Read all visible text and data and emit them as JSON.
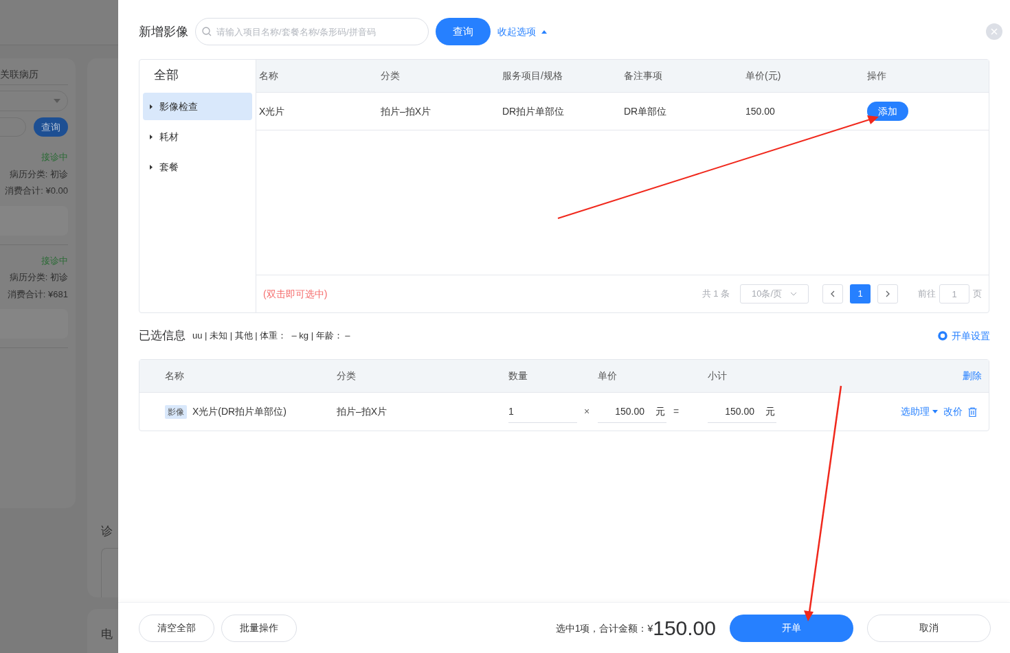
{
  "background_page": {
    "panel_title": "关联病历",
    "query_button": "查询",
    "records": [
      {
        "status": "接诊中",
        "category": "病历分类: 初诊",
        "total": "消费合计: ¥0.00"
      },
      {
        "status": "接诊中",
        "category": "病历分类: 初诊",
        "total": "消费合计: ¥681"
      }
    ],
    "section_labels": [
      "诊",
      "电"
    ]
  },
  "dialog": {
    "title": "新增影像",
    "search": {
      "placeholder": "请输入项目名称/套餐名称/条形码/拼音码"
    },
    "query_button": "查询",
    "collapse_link": "收起选项",
    "categories": {
      "all": "全部",
      "items": [
        {
          "label": "影像检查",
          "selected": true
        },
        {
          "label": "耗材",
          "selected": false
        },
        {
          "label": "套餐",
          "selected": false
        }
      ]
    },
    "catalog_table": {
      "columns": [
        "名称",
        "分类",
        "服务项目/规格",
        "备注事项",
        "单价(元)",
        "操作"
      ],
      "rows": [
        {
          "cells": [
            "X光片",
            "拍片–拍X片",
            "DR拍片单部位",
            "DR单部位",
            "150.00"
          ],
          "action": "添加"
        }
      ],
      "hint": "(双击即可选中)",
      "pagination": {
        "total": "共 1 条",
        "page_size": "10条/页",
        "pages": [
          {
            "label": "1",
            "selected": true
          }
        ],
        "goto_label": "前往",
        "goto_value": "1",
        "goto_suffix": "页"
      }
    },
    "selected_info": {
      "title": "已选信息",
      "patient": "uu | 未知 | 其他 | 体重：  – kg | 年龄： –",
      "settings_link": "开单设置"
    },
    "selected_table": {
      "columns": [
        "名称",
        "分类",
        "数量",
        "单价",
        "小计"
      ],
      "delete_all": "删除",
      "rows": [
        {
          "tag": "影像",
          "name": "X光片(DR拍片单部位)",
          "category": "拍片–拍X片",
          "quantity": "1",
          "times": "×",
          "price": "150.00",
          "price_unit": "元",
          "equals": "=",
          "subtotal": "150.00",
          "subtotal_unit": "元",
          "assistant": "选助理",
          "change_price": "改价"
        }
      ]
    },
    "footer": {
      "clear_button": "清空全部",
      "batch_button": "批量操作",
      "summary": "选中1项，合计金额：¥",
      "total": "150.00",
      "submit_button": "开单",
      "cancel_button": "取消"
    }
  }
}
